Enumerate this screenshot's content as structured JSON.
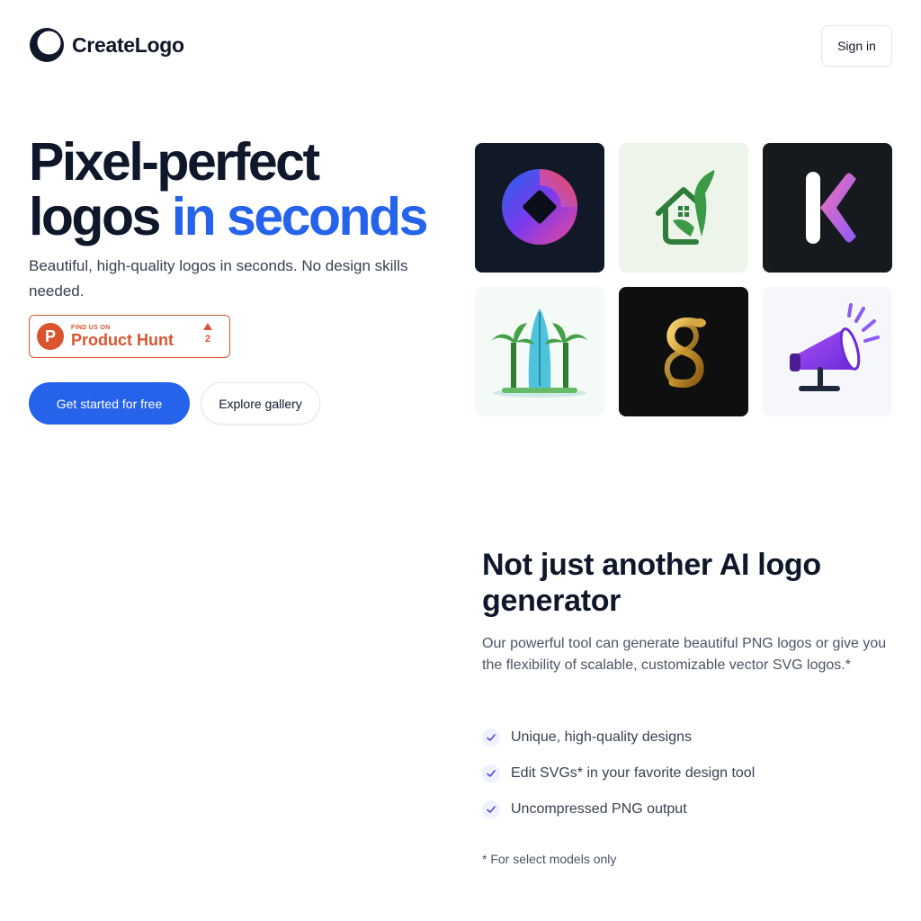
{
  "header": {
    "brand_name": "CreateLogo",
    "signin_label": "Sign in"
  },
  "hero": {
    "title_line1": "Pixel-perfect",
    "title_line2_plain": "logos",
    "title_line2_accent": "in seconds",
    "subtitle": "Beautiful, high-quality logos in seconds. No design skills needed.",
    "product_hunt": {
      "find_text": "FIND US ON",
      "name": "Product Hunt",
      "votes": "2"
    },
    "primary_cta": "Get started for free",
    "secondary_cta": "Explore gallery"
  },
  "gallery": {
    "tiles": [
      {
        "name": "swirl-o-logo",
        "bg": "#111827"
      },
      {
        "name": "leaf-house-logo",
        "bg": "#edf5ea"
      },
      {
        "name": "letter-k-logo",
        "bg": "#161a1e"
      },
      {
        "name": "palm-surfboard-logo",
        "bg": "#f4faf6"
      },
      {
        "name": "gold-serpent-logo",
        "bg": "#0f0f0f"
      },
      {
        "name": "megaphone-logo",
        "bg": "#f5f7fb"
      }
    ]
  },
  "features": {
    "title": "Not just another AI logo generator",
    "description": "Our powerful tool can generate beautiful PNG logos or give you the flexibility of scalable, customizable vector SVG logos.*",
    "items": [
      {
        "label": "Unique, high-quality designs",
        "icon": "check-icon"
      },
      {
        "label": "Edit SVGs* in your favorite design tool",
        "icon": "check-icon"
      },
      {
        "label": "Uncompressed PNG output",
        "icon": "check-icon"
      }
    ],
    "footnote": "* For select models only"
  },
  "colors": {
    "accent": "#2563eb",
    "text": "#0f172a",
    "product_hunt": "#da552f"
  }
}
